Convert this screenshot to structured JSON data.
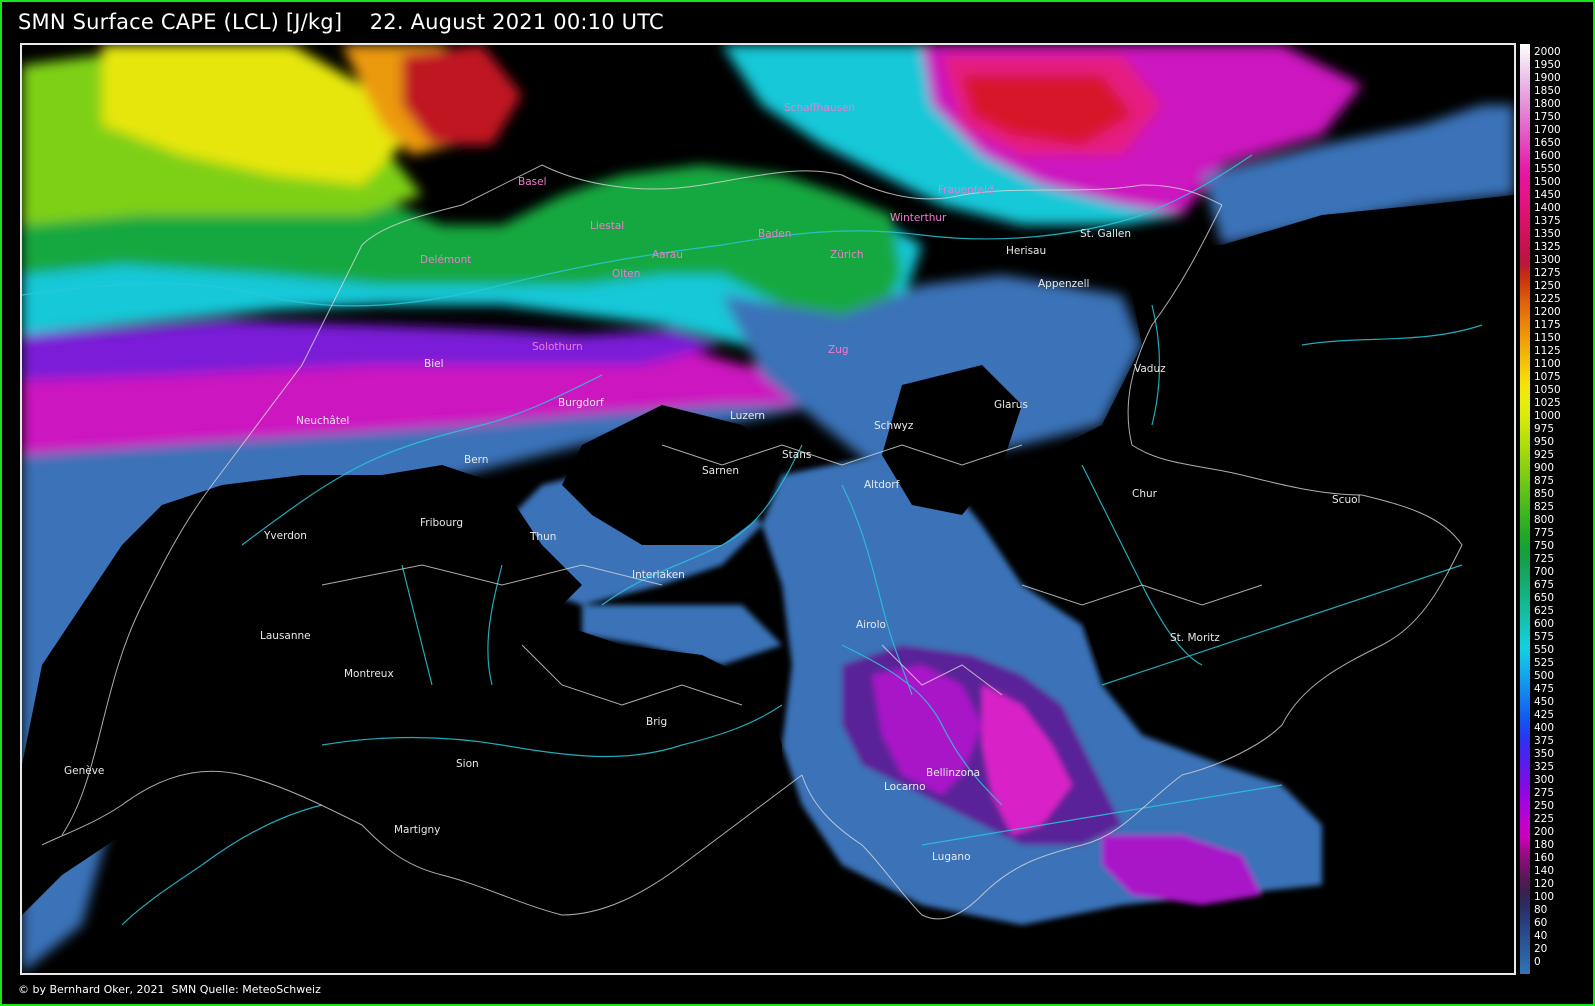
{
  "title": "SMN Surface CAPE (LCL) [J/kg]    22. August 2021 00:10 UTC",
  "footer": "© by Bernhard Oker, 2021  SMN Quelle: MeteoSchweiz",
  "colors": {
    "frame": "#19e619",
    "background": "#000000",
    "rivers": "#27c8d8",
    "borders": "#d8d8d8"
  },
  "legend": {
    "labels": [
      "2000",
      "1950",
      "1900",
      "1850",
      "1800",
      "1750",
      "1700",
      "1650",
      "1600",
      "1550",
      "1500",
      "1450",
      "1400",
      "1375",
      "1350",
      "1325",
      "1300",
      "1275",
      "1250",
      "1225",
      "1200",
      "1175",
      "1150",
      "1125",
      "1100",
      "1075",
      "1050",
      "1025",
      "1000",
      "975",
      "950",
      "925",
      "900",
      "875",
      "850",
      "825",
      "800",
      "775",
      "750",
      "725",
      "700",
      "675",
      "650",
      "625",
      "600",
      "575",
      "550",
      "525",
      "500",
      "475",
      "450",
      "425",
      "400",
      "375",
      "350",
      "325",
      "300",
      "275",
      "250",
      "225",
      "200",
      "180",
      "160",
      "140",
      "120",
      "100",
      "80",
      "60",
      "40",
      "20",
      "0"
    ],
    "colors": [
      "#ffffff",
      "#f6e6f6",
      "#f0cdef",
      "#eab4e7",
      "#e69bde",
      "#e482d6",
      "#e468cc",
      "#e44fc1",
      "#e536b5",
      "#e61ea8",
      "#e6129a",
      "#e6128a",
      "#e0127a",
      "#d8126a",
      "#cf125a",
      "#c4124c",
      "#b8163e",
      "#c6300e",
      "#d44a0a",
      "#e0640a",
      "#e67a0a",
      "#ec900a",
      "#f0a60a",
      "#f2bc0a",
      "#f4d20a",
      "#f4e40a",
      "#ecec0a",
      "#dcec0a",
      "#c8e60a",
      "#b4e00a",
      "#9ed80e",
      "#88d012",
      "#72c816",
      "#5cc01a",
      "#46b81e",
      "#30b022",
      "#1ea826",
      "#16a03a",
      "#14a050",
      "#14a866",
      "#14b07c",
      "#14b894",
      "#14c0ac",
      "#14c8c4",
      "#14d0dc",
      "#14c0e8",
      "#14a8ec",
      "#1490ee",
      "#1478f0",
      "#1460f0",
      "#1c48f0",
      "#3030f0",
      "#4a24ec",
      "#6418e8",
      "#7e0ce4",
      "#9806e0",
      "#b002d8",
      "#c200cc",
      "#cc00bc",
      "#a2088a",
      "#7c1070",
      "#581858",
      "#3c2050",
      "#2c2c60",
      "#283c78",
      "#284a8c",
      "#2a5898",
      "#2e66a8",
      "#3474b8"
    ]
  },
  "cities": [
    {
      "name": "Schaffhausen",
      "cls": "pink"
    },
    {
      "name": "Frauenfeld",
      "cls": "pink"
    },
    {
      "name": "Basel",
      "cls": "pink"
    },
    {
      "name": "Liestal",
      "cls": "pink"
    },
    {
      "name": "Baden",
      "cls": "pink"
    },
    {
      "name": "Winterthur",
      "cls": "pink"
    },
    {
      "name": "St. Gallen",
      "cls": "light"
    },
    {
      "name": "Herisau",
      "cls": "light"
    },
    {
      "name": "Delémont",
      "cls": "pink"
    },
    {
      "name": "Aarau",
      "cls": "pink"
    },
    {
      "name": "Zürich",
      "cls": "pink"
    },
    {
      "name": "Olten",
      "cls": "pink"
    },
    {
      "name": "Appenzell",
      "cls": "light"
    },
    {
      "name": "Solothurn",
      "cls": "pink"
    },
    {
      "name": "Zug",
      "cls": "pink"
    },
    {
      "name": "Biel",
      "cls": "light"
    },
    {
      "name": "Vaduz",
      "cls": "light"
    },
    {
      "name": "Burgdorf",
      "cls": "light"
    },
    {
      "name": "Glarus",
      "cls": "light"
    },
    {
      "name": "Luzern",
      "cls": "light"
    },
    {
      "name": "Neuchâtel",
      "cls": "light"
    },
    {
      "name": "Schwyz",
      "cls": "light"
    },
    {
      "name": "Bern",
      "cls": "light"
    },
    {
      "name": "Stans",
      "cls": "light"
    },
    {
      "name": "Sarnen",
      "cls": "light"
    },
    {
      "name": "Altdorf",
      "cls": "light"
    },
    {
      "name": "Chur",
      "cls": "light"
    },
    {
      "name": "Scuol",
      "cls": "light"
    },
    {
      "name": "Fribourg",
      "cls": "light"
    },
    {
      "name": "Yverdon",
      "cls": "light"
    },
    {
      "name": "Thun",
      "cls": "light"
    },
    {
      "name": "Interlaken",
      "cls": "light"
    },
    {
      "name": "Airolo",
      "cls": "light"
    },
    {
      "name": "Lausanne",
      "cls": "light"
    },
    {
      "name": "St. Moritz",
      "cls": "light"
    },
    {
      "name": "Montreux",
      "cls": "light"
    },
    {
      "name": "Brig",
      "cls": "light"
    },
    {
      "name": "Bellinzona",
      "cls": "light"
    },
    {
      "name": "Genève",
      "cls": "light"
    },
    {
      "name": "Sion",
      "cls": "light"
    },
    {
      "name": "Locarno",
      "cls": "light"
    },
    {
      "name": "Martigny",
      "cls": "light"
    },
    {
      "name": "Lugano",
      "cls": "light"
    }
  ]
}
